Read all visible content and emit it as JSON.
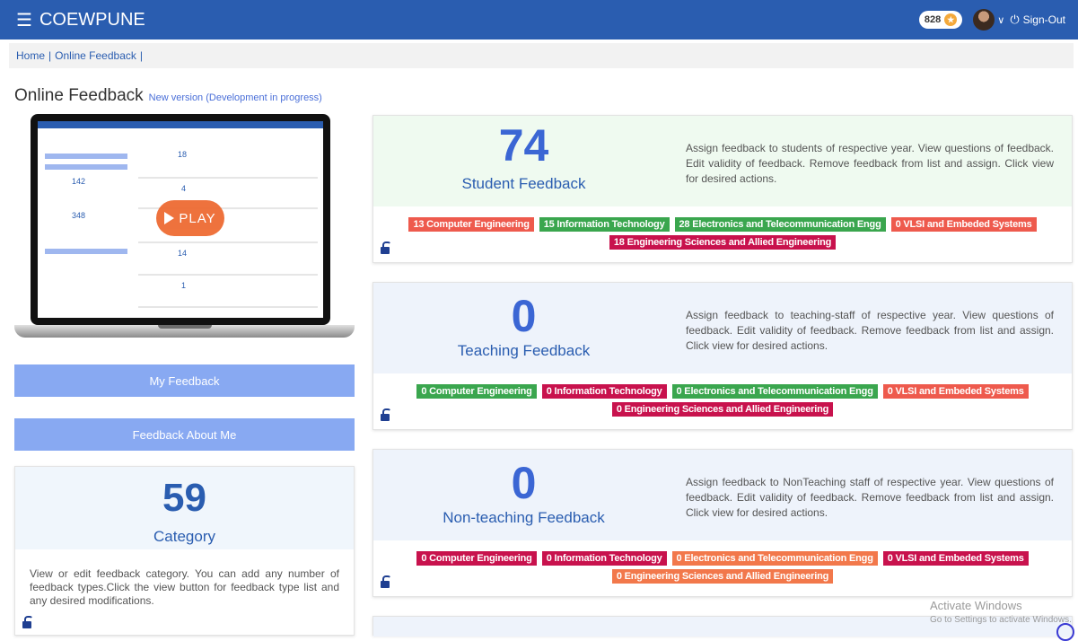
{
  "header": {
    "brand": "COEWPUNE",
    "points": "828",
    "signout_label": "Sign-Out",
    "colors": {
      "navbar": "#2a5db0"
    }
  },
  "breadcrumb": {
    "home": "Home",
    "current": "Online Feedback",
    "separator": "|"
  },
  "page": {
    "title": "Online Feedback",
    "subtitle": "New version (Development in progress)"
  },
  "video": {
    "play_label": "PLAY",
    "mini_numbers": [
      "18",
      "142",
      "4",
      "348",
      "14",
      "1"
    ]
  },
  "sidebar": {
    "my_feedback": "My Feedback",
    "feedback_about_me": "Feedback About Me"
  },
  "category": {
    "count": "59",
    "label": "Category",
    "description": "View or edit feedback category. You can add any number of feedback types.Click the view button for feedback type list and any desired modifications."
  },
  "cards": [
    {
      "count": "74",
      "title": "Student Feedback",
      "description": "Assign feedback to students of respective year. View questions of feedback. Edit validity of feedback. Remove feedback from list and assign. Click view for desired actions.",
      "tags": [
        {
          "label": "13 Computer Engineering",
          "color": "red"
        },
        {
          "label": "15 Information Technology",
          "color": "green"
        },
        {
          "label": "28 Electronics and Telecommunication Engg",
          "color": "green"
        },
        {
          "label": "0 VLSI and Embeded Systems",
          "color": "red"
        },
        {
          "label": "18 Engineering Sciences and Allied Engineering",
          "color": "crimson"
        }
      ]
    },
    {
      "count": "0",
      "title": "Teaching Feedback",
      "description": "Assign feedback to teaching-staff of respective year. View questions of feedback. Edit validity of feedback. Remove feedback from list and assign. Click view for desired actions.",
      "tags": [
        {
          "label": "0 Computer Engineering",
          "color": "green"
        },
        {
          "label": "0 Information Technology",
          "color": "crimson"
        },
        {
          "label": "0 Electronics and Telecommunication Engg",
          "color": "green"
        },
        {
          "label": "0 VLSI and Embeded Systems",
          "color": "red"
        },
        {
          "label": "0 Engineering Sciences and Allied Engineering",
          "color": "crimson"
        }
      ]
    },
    {
      "count": "0",
      "title": "Non-teaching Feedback",
      "description": "Assign feedback to NonTeaching staff of respective year. View questions of feedback. Edit validity of feedback. Remove feedback from list and assign. Click view for desired actions.",
      "tags": [
        {
          "label": "0 Computer Engineering",
          "color": "crimson"
        },
        {
          "label": "0 Information Technology",
          "color": "crimson"
        },
        {
          "label": "0 Electronics and Telecommunication Engg",
          "color": "orange"
        },
        {
          "label": "0 VLSI and Embeded Systems",
          "color": "crimson"
        },
        {
          "label": "0 Engineering Sciences and Allied Engineering",
          "color": "orange"
        }
      ]
    }
  ],
  "watermark": {
    "line1": "Activate Windows",
    "line2": "Go to Settings to activate Windows."
  },
  "icons": {
    "menu": "hamburger-icon",
    "trophy": "trophy-icon",
    "power": "power-icon",
    "lock": "unlock-icon"
  }
}
